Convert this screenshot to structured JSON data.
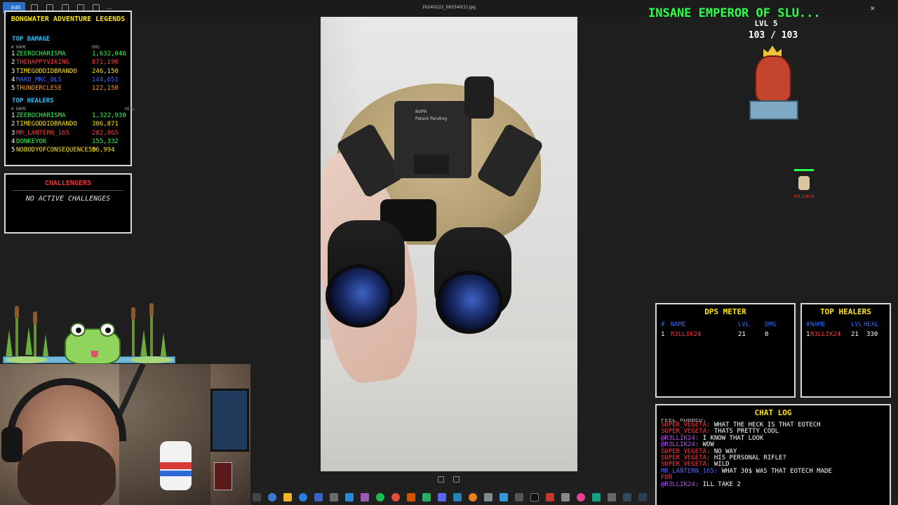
{
  "viewer": {
    "edit_label": "Edit",
    "filename": "20240222_093340(1).jpg"
  },
  "leaderboard": {
    "title": "BONGWATER ADVENTURE LEGENDS",
    "damage": {
      "heading": "TOP DAMAGE",
      "col_rank": "#",
      "col_name": "NAME",
      "col_value": "DMG",
      "rows": [
        {
          "rank": "1",
          "name": "ZEEROCHARISMA",
          "value": "1,632,046",
          "color": "#2aff4a"
        },
        {
          "rank": "2",
          "name": "THEHAPPYVIKING",
          "value": "871,190",
          "color": "#ff3b3b"
        },
        {
          "rank": "3",
          "name": "TIMEGODDIDBRANDO",
          "value": "246,150",
          "color": "#ffe600"
        },
        {
          "rank": "4",
          "name": "MAKO_MKC_DLS",
          "value": "144,651",
          "color": "#3a6bff"
        },
        {
          "rank": "5",
          "name": "THUNDERCLESE",
          "value": "122,150",
          "color": "#ff9a1a"
        }
      ]
    },
    "healers": {
      "heading": "TOP HEALERS",
      "col_rank": "#",
      "col_name": "NAME",
      "col_value": "HEAL",
      "rows": [
        {
          "rank": "1",
          "name": "ZEEROCHARISMA",
          "value": "1,322,930",
          "color": "#2aff4a"
        },
        {
          "rank": "2",
          "name": "TIMEGODDIDBRANDO",
          "value": "306,871",
          "color": "#ffe600"
        },
        {
          "rank": "3",
          "name": "MR_LANTERN_165",
          "value": "282,865",
          "color": "#ff3b3b"
        },
        {
          "rank": "4",
          "name": "DONKEYOK",
          "value": "155,332",
          "color": "#2aff4a"
        },
        {
          "rank": "5",
          "name": "NOBODYOFCONSEQUENCE50",
          "value": "56,994",
          "color": "#ffe600"
        }
      ]
    }
  },
  "challengers": {
    "title": "CHALLENGERS",
    "message": "NO ACTIVE CHALLENGES"
  },
  "boss": {
    "name": "INSANE EMPEROR OF SLU...",
    "level": "LVL 5",
    "hp": "103 / 103"
  },
  "player": {
    "name": "R3LLIK24"
  },
  "dps": {
    "title": "DPS METER",
    "col_rank": "#",
    "col_name": "NAME",
    "col_lvl": "LVL",
    "col_dmg": "DMG",
    "rows": [
      {
        "rank": "1",
        "name": "R3LLIK24",
        "lvl": "21",
        "dmg": "0"
      }
    ]
  },
  "top_healers": {
    "title": "TOP HEALERS",
    "col_rank": "#",
    "col_name": "NAME",
    "col_lvl": "LVL",
    "col_heal": "HEAL",
    "rows": [
      {
        "rank": "1",
        "name": "R3LLIK24",
        "lvl": "21",
        "heal": "330"
      }
    ]
  },
  "chat": {
    "title": "CHAT LOG",
    "cut_line": "FEEL ROBBED.",
    "messages": [
      {
        "user": "SUPER_VEGETA:",
        "text": "WHAT THE HECK IS THAT EOTECH",
        "cls": "u1"
      },
      {
        "user": "SUPER_VEGETA:",
        "text": "THATS PRETTY COOL",
        "cls": "u1"
      },
      {
        "user": "@R3LLIK24:",
        "text": "I KNOW THAT LOOK",
        "cls": "u2"
      },
      {
        "user": "@R3LLIK24:",
        "text": "WOW",
        "cls": "u2"
      },
      {
        "user": "SUPER_VEGETA:",
        "text": "NO WAY",
        "cls": "u1"
      },
      {
        "user": "SUPER_VEGETA:",
        "text": "HIS PERSONAL RIFLE?",
        "cls": "u1"
      },
      {
        "user": "SUPER_VEGETA:",
        "text": "WILD",
        "cls": "u1"
      },
      {
        "user": "MR_LANTERN_165:",
        "text": "WHAT 30$ WAS THAT EOTECH MADE",
        "cls": "u4"
      },
      {
        "user": "FOR",
        "text": "",
        "cls": "u3"
      },
      {
        "user": "@R3LLIK24:",
        "text": "ILL TAKE 2",
        "cls": "u2"
      }
    ]
  },
  "photo_labels": {
    "brand": "NVPR",
    "patent": "Patent Pending"
  },
  "colors": {
    "boss_title": "#2aff4a",
    "panel_title": "#ffe600",
    "challengers_title": "#ff2b2b",
    "section": "#22c3ff"
  }
}
